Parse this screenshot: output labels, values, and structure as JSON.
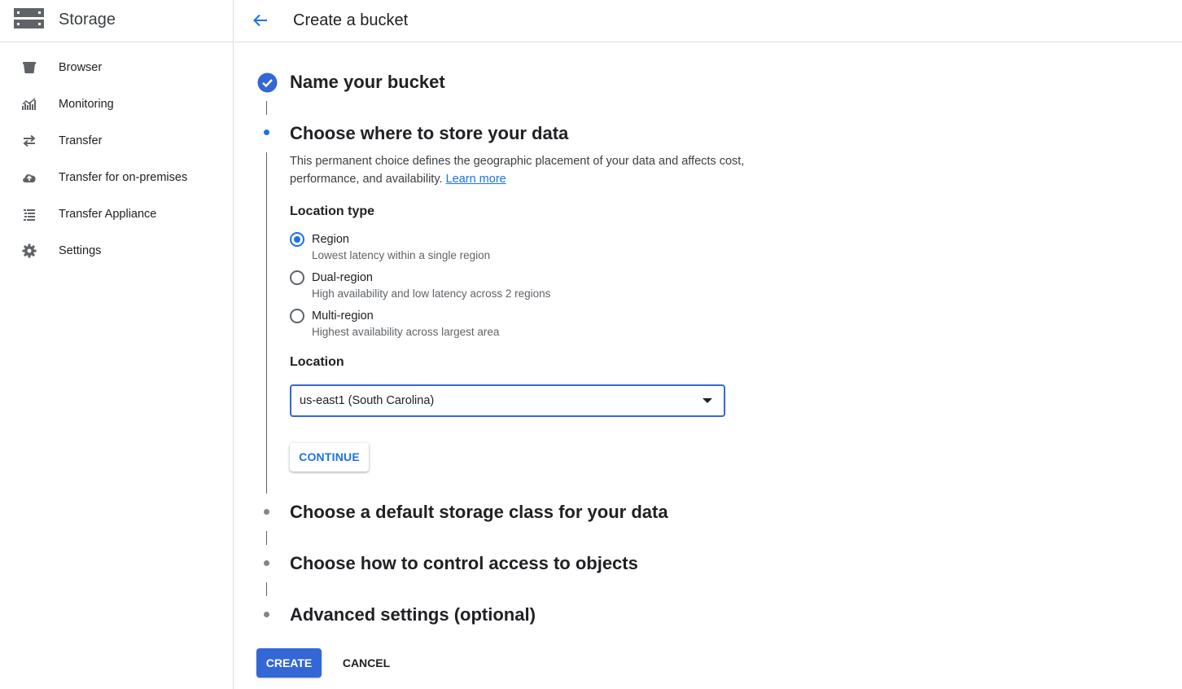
{
  "sidebar": {
    "product_title": "Storage",
    "product_icon": "storage-icon",
    "items": [
      {
        "label": "Browser",
        "icon": "bucket-icon"
      },
      {
        "label": "Monitoring",
        "icon": "monitoring-chart-icon"
      },
      {
        "label": "Transfer",
        "icon": "transfer-arrows-icon"
      },
      {
        "label": "Transfer for on-premises",
        "icon": "cloud-upload-icon"
      },
      {
        "label": "Transfer Appliance",
        "icon": "list-icon"
      },
      {
        "label": "Settings",
        "icon": "gear-icon"
      }
    ]
  },
  "header": {
    "title": "Create a bucket",
    "back_icon": "arrow-back-icon"
  },
  "stepper": {
    "steps": [
      {
        "title": "Name your bucket",
        "state": "done"
      },
      {
        "title": "Choose where to store your data",
        "state": "active"
      },
      {
        "title": "Choose a default storage class for your data",
        "state": "pending"
      },
      {
        "title": "Choose how to control access to objects",
        "state": "pending"
      },
      {
        "title": "Advanced settings (optional)",
        "state": "pending"
      }
    ],
    "active_step": {
      "description": "This permanent choice defines the geographic placement of your data and affects cost, performance, and availability.",
      "learn_more": "Learn more",
      "location_type_label": "Location type",
      "location_types": [
        {
          "label": "Region",
          "sub": "Lowest latency within a single region",
          "checked": true
        },
        {
          "label": "Dual-region",
          "sub": "High availability and low latency across 2 regions",
          "checked": false
        },
        {
          "label": "Multi-region",
          "sub": "Highest availability across largest area",
          "checked": false
        }
      ],
      "location_label": "Location",
      "location_value": "us-east1 (South Carolina)",
      "continue_label": "CONTINUE"
    }
  },
  "actions": {
    "create_label": "CREATE",
    "cancel_label": "CANCEL"
  },
  "colors": {
    "accent": "#1a73e8",
    "primary_button": "#3367d6",
    "border": "#dadce0",
    "icon_gray": "#5f6368"
  }
}
